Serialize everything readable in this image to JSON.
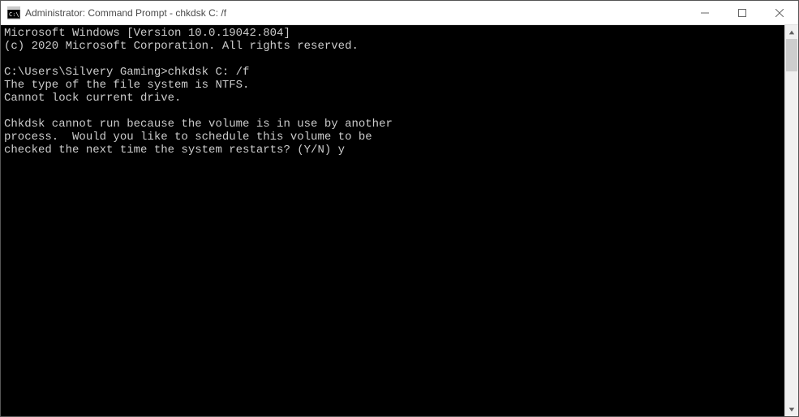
{
  "window": {
    "title": "Administrator: Command Prompt - chkdsk  C: /f"
  },
  "terminal": {
    "lines": [
      "Microsoft Windows [Version 10.0.19042.804]",
      "(c) 2020 Microsoft Corporation. All rights reserved.",
      "",
      "C:\\Users\\Silvery Gaming>chkdsk C: /f",
      "The type of the file system is NTFS.",
      "Cannot lock current drive.",
      "",
      "Chkdsk cannot run because the volume is in use by another",
      "process.  Would you like to schedule this volume to be",
      "checked the next time the system restarts? (Y/N) y"
    ]
  }
}
